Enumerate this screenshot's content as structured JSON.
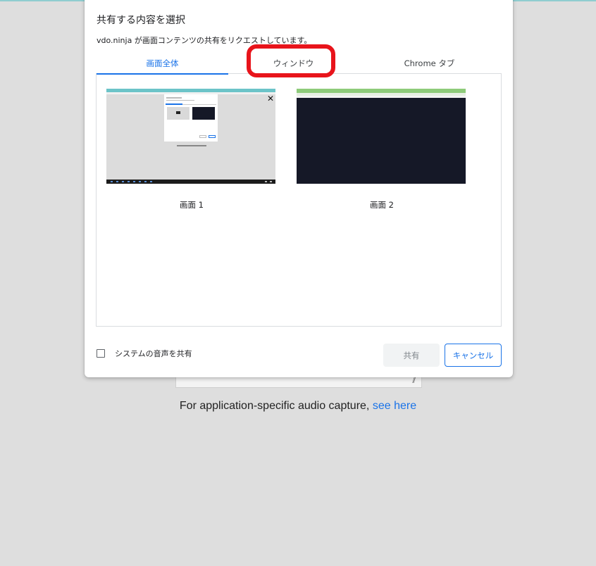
{
  "dialog": {
    "title": "共有する内容を選択",
    "subtitle": "vdo.ninja が画面コンテンツの共有をリクエストしています。",
    "tabs": [
      {
        "label": "画面全体",
        "active": true
      },
      {
        "label": "ウィンドウ",
        "active": false,
        "highlighted": true
      },
      {
        "label": "Chrome タブ",
        "active": false
      }
    ],
    "sources": [
      {
        "label": "画面 1"
      },
      {
        "label": "画面 2"
      }
    ],
    "checkbox_label": "システムの音声を共有",
    "checkbox_checked": false,
    "share_button": "共有",
    "share_enabled": false,
    "cancel_button": "キャンセル"
  },
  "background_page": {
    "text": "For application-specific audio capture,",
    "link": "see here"
  },
  "colors": {
    "accent": "#1a73e8",
    "highlight": "#e8141b",
    "page_bg": "#dedede"
  }
}
